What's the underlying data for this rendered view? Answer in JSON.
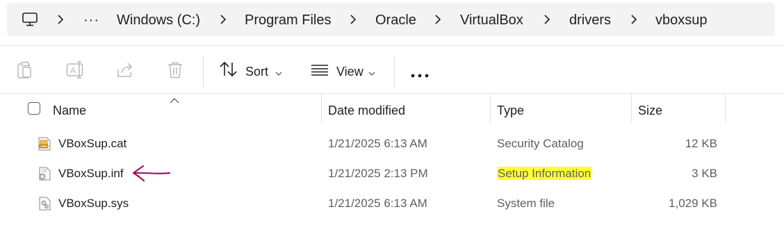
{
  "breadcrumb": {
    "items": [
      "Windows (C:)",
      "Program Files",
      "Oracle",
      "VirtualBox",
      "drivers",
      "vboxsup"
    ],
    "overflow_label": "···",
    "root_icon": "computer-icon"
  },
  "toolbar": {
    "copy_icon": "clipboard-icon",
    "rename_icon": "rename-icon",
    "share_icon": "share-icon",
    "delete_icon": "trash-icon",
    "sort_label": "Sort",
    "view_label": "View",
    "more_label": "···"
  },
  "columns": {
    "name": "Name",
    "date": "Date modified",
    "type": "Type",
    "size": "Size",
    "sort_column": "Name",
    "sort_direction": "ascending"
  },
  "files": [
    {
      "name": "VBoxSup.cat",
      "date": "1/21/2025 6:13 AM",
      "type": "Security Catalog",
      "size": "12 KB",
      "icon": "security-catalog-icon",
      "highlighted": false
    },
    {
      "name": "VBoxSup.inf",
      "date": "1/21/2025 2:13 PM",
      "type": "Setup Information",
      "size": "3 KB",
      "icon": "setup-info-icon",
      "highlighted": true
    },
    {
      "name": "VBoxSup.sys",
      "date": "1/21/2025 6:13 AM",
      "type": "System file",
      "size": "1,029 KB",
      "icon": "system-file-icon",
      "highlighted": false
    }
  ],
  "colors": {
    "highlight": "#ffff33",
    "annotation_arrow": "#a0155e",
    "addressbar_bg": "#f3f3f3"
  }
}
